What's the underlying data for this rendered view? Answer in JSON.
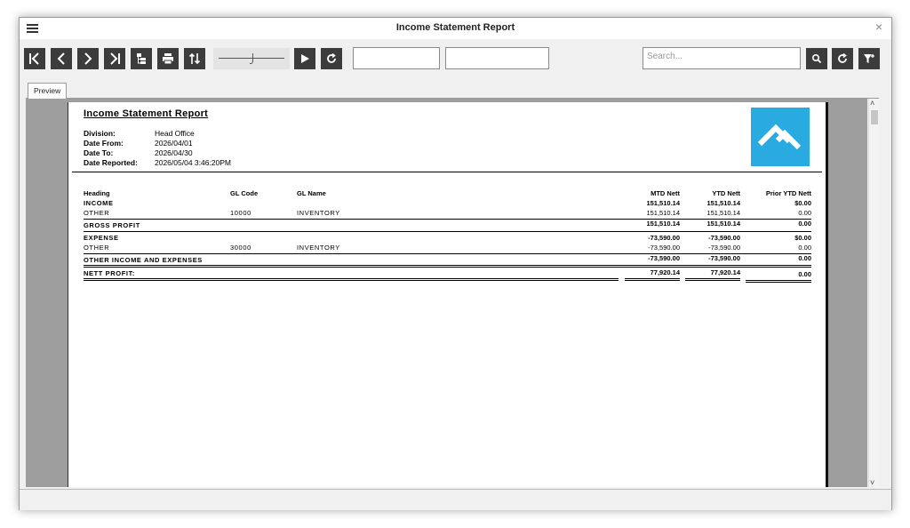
{
  "window": {
    "title": "Income Statement Report"
  },
  "toolbar": {
    "search_placeholder": "Search...",
    "input1_value": "",
    "input2_value": ""
  },
  "tab": {
    "label": "Preview"
  },
  "report": {
    "title": "Income Statement Report",
    "info": [
      {
        "key": "Division:",
        "value": "Head Office"
      },
      {
        "key": "Date From:",
        "value": "2026/04/01"
      },
      {
        "key": "Date To:",
        "value": "2026/04/30"
      },
      {
        "key": "Date Reported:",
        "value": "2026/05/04 3:46:20PM"
      }
    ],
    "columns": {
      "heading": "Heading",
      "gl_code": "GL Code",
      "gl_name": "GL Name",
      "mtd": "MTD Nett",
      "ytd": "YTD Nett",
      "prior": "Prior YTD Nett"
    },
    "income": {
      "label": "INCOME",
      "mtd": "151,510.14",
      "ytd": "151,510.14",
      "prior": "$0.00"
    },
    "income_row": {
      "heading": "OTHER",
      "code": "10000",
      "name": "INVENTORY",
      "mtd": "151,510.14",
      "ytd": "151,510.14",
      "prior": "0.00"
    },
    "gross_profit": {
      "label": "GROSS PROFIT",
      "mtd": "151,510.14",
      "ytd": "151,510.14",
      "prior": "0.00"
    },
    "expense": {
      "label": "EXPENSE",
      "mtd": "-73,590.00",
      "ytd": "-73,590.00",
      "prior": "$0.00"
    },
    "expense_row": {
      "heading": "OTHER",
      "code": "30000",
      "name": "INVENTORY",
      "mtd": "-73,590.00",
      "ytd": "-73,590.00",
      "prior": "0.00"
    },
    "other_ie": {
      "label": "OTHER INCOME AND EXPENSES",
      "mtd": "-73,590.00",
      "ytd": "-73,590.00",
      "prior": "0.00"
    },
    "nett_profit": {
      "label": "NETT PROFIT:",
      "mtd": "77,920.14",
      "ytd": "77,920.14",
      "prior": "0.00"
    }
  },
  "colors": {
    "accent": "#29abe2",
    "button": "#3c3c3c"
  }
}
